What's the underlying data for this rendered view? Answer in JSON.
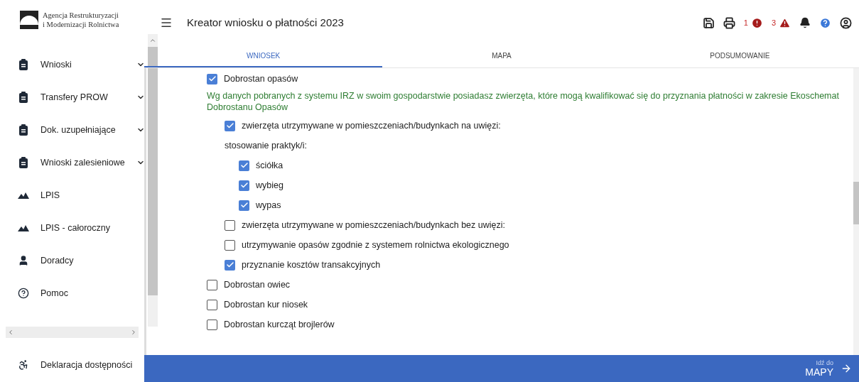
{
  "logo": {
    "line1": "Agencja Restrukturyzacji",
    "line2": "i Modernizacji Rolnictwa"
  },
  "sidebar": {
    "items": [
      {
        "label": "Wnioski",
        "kind": "clipboard",
        "expandable": true
      },
      {
        "label": "Transfery PROW",
        "kind": "clipboard",
        "expandable": true
      },
      {
        "label": "Dok. uzupełniające",
        "kind": "clipboard",
        "expandable": true
      },
      {
        "label": "Wnioski zalesieniowe",
        "kind": "clipboard",
        "expandable": true
      },
      {
        "label": "LPIS",
        "kind": "mountains",
        "expandable": false
      },
      {
        "label": "LPIS - całoroczny",
        "kind": "mountains",
        "expandable": false
      },
      {
        "label": "Doradcy",
        "kind": "person",
        "expandable": false
      },
      {
        "label": "Pomoc",
        "kind": "help",
        "expandable": false
      }
    ],
    "footer": {
      "label": "Deklaracja dostępności",
      "kind": "accessibility"
    }
  },
  "header": {
    "title": "Kreator wniosku o płatności 2023",
    "errors": "1",
    "warnings": "3"
  },
  "tabs": [
    {
      "label": "WNIOSEK",
      "selected": true
    },
    {
      "label": "MAPA",
      "selected": false
    },
    {
      "label": "PODSUMOWANIE",
      "selected": false
    }
  ],
  "options": [
    {
      "label": "Dobrostan opasów",
      "checked": true,
      "note": "Wg danych pobranych z systemu IRZ w swoim gospodarstwie posiadasz zwierzęta, które mogą kwalifikować się do przyznania płatności w zakresie Ekoschemat Dobrostanu Opasów",
      "children": [
        {
          "label": "zwierzęta utrzymywane w pomieszczeniach/budynkach na uwięzi:",
          "checked": true,
          "sublabel": "stosowanie praktyk/i:",
          "children": [
            {
              "label": "ściółka",
              "checked": true
            },
            {
              "label": "wybieg",
              "checked": true
            },
            {
              "label": "wypas",
              "checked": true
            }
          ]
        },
        {
          "label": "zwierzęta utrzymywane w pomieszczeniach/budynkach bez uwięzi:",
          "checked": false
        },
        {
          "label": "utrzymywanie opasów zgodnie z systemem rolnictwa ekologicznego",
          "checked": false
        },
        {
          "label": "przyznanie kosztów transakcyjnych",
          "checked": true
        }
      ]
    },
    {
      "label": "Dobrostan owiec",
      "checked": false
    },
    {
      "label": "Dobrostan kur niosek",
      "checked": false
    },
    {
      "label": "Dobrostan kurcząt brojlerów",
      "checked": false
    }
  ],
  "footer_bar": {
    "hint": "Idź do",
    "action": "MAPY"
  }
}
